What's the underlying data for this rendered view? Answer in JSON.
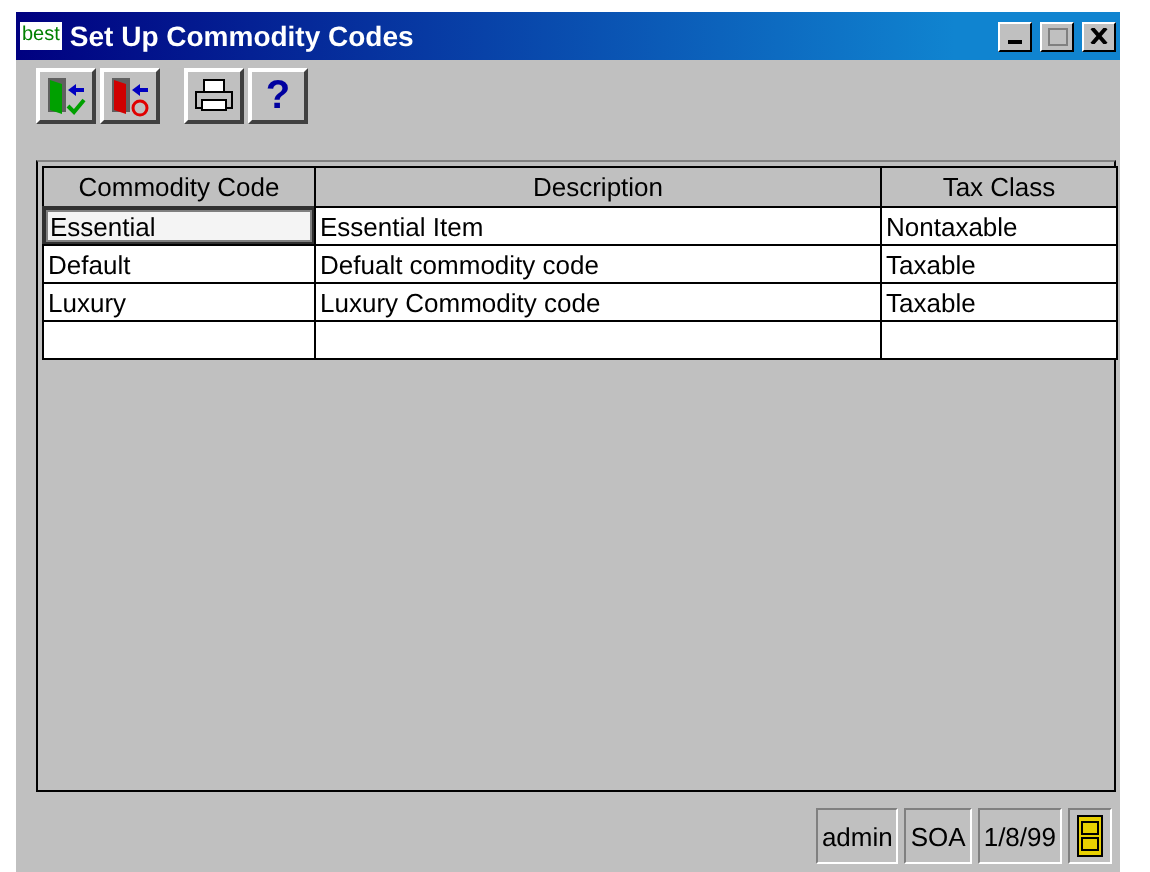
{
  "window": {
    "title": "Set Up Commodity Codes",
    "logo": "best"
  },
  "toolbar": [
    {
      "kind": "door-green"
    },
    {
      "kind": "door-red"
    },
    {
      "kind": "printer"
    },
    {
      "kind": "help",
      "label": "?"
    }
  ],
  "table": {
    "columns": [
      "Commodity Code",
      "Description",
      "Tax Class"
    ],
    "rows": [
      {
        "cells": [
          "Essential",
          "Essential Item",
          "Nontaxable"
        ],
        "selected": true
      },
      {
        "cells": [
          "Default",
          "Defualt commodity code",
          "Taxable"
        ],
        "selected": false
      },
      {
        "cells": [
          "Luxury",
          "Luxury Commodity code",
          "Taxable"
        ],
        "selected": false
      },
      {
        "cells": [],
        "selected": false
      }
    ]
  },
  "status_bar": [
    "admin",
    "SOA",
    "1/8/99"
  ]
}
